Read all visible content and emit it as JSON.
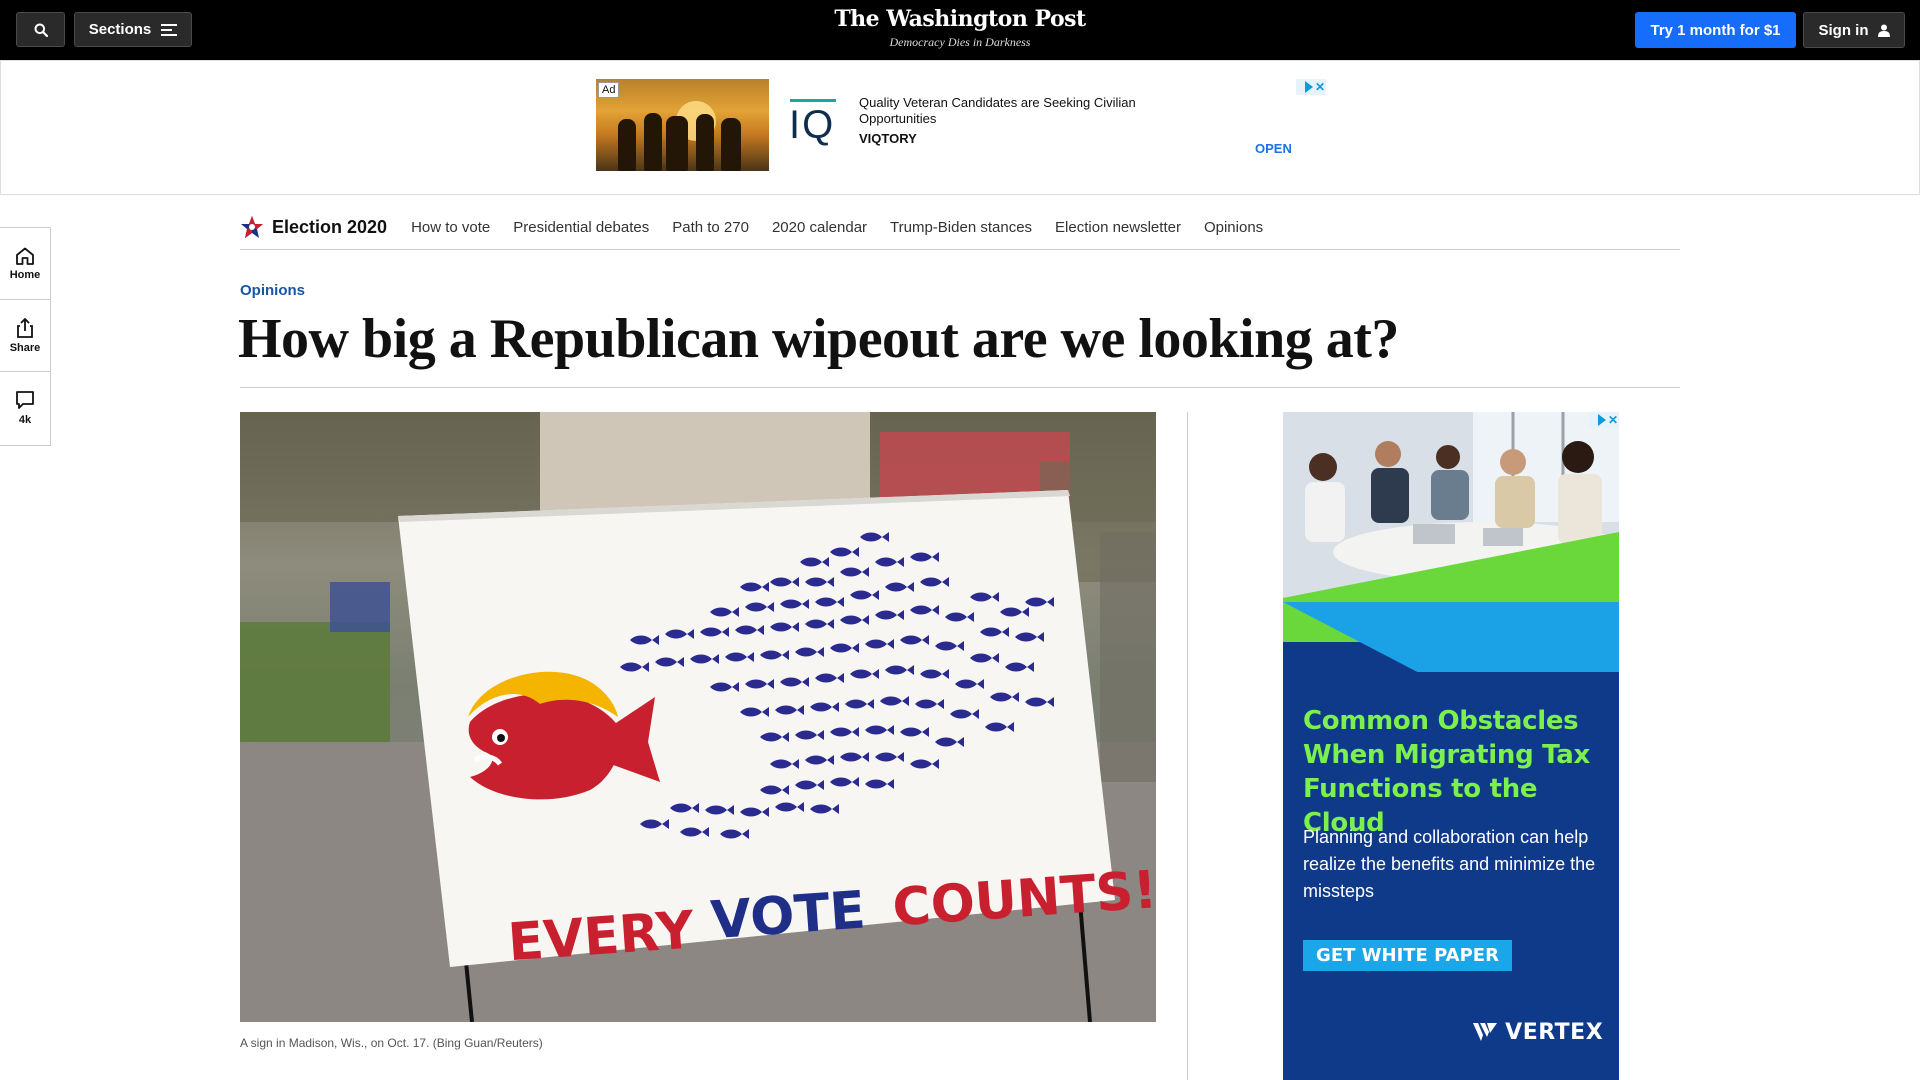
{
  "topbar": {
    "search_icon": "search-icon",
    "sections_label": "Sections",
    "masthead_logo": "The Washington Post",
    "masthead_tagline": "Democracy Dies in Darkness",
    "try_label": "Try 1 month for $1",
    "signin_label": "Sign in"
  },
  "top_ad": {
    "badge": "Ad",
    "logo_text": "IQ",
    "headline": "Quality Veteran Candidates are Seeking Civilian Opportunities",
    "brand": "VIQTORY",
    "cta": "OPEN"
  },
  "election_nav": {
    "title": "Election 2020",
    "links": [
      "How to vote",
      "Presidential debates",
      "Path to 270",
      "2020 calendar",
      "Trump-Biden stances",
      "Election newsletter",
      "Opinions"
    ]
  },
  "left_rail": {
    "home_label": "Home",
    "share_label": "Share",
    "comments_label": "4k"
  },
  "article": {
    "kicker": "Opinions",
    "headline": "How big a Republican wipeout are we looking at?",
    "image_sign_text": [
      "EVERY",
      "VOTE",
      "COUNTS!"
    ],
    "caption": "A sign in Madison, Wis., on Oct. 17. (Bing Guan/Reuters)"
  },
  "right_ad": {
    "headline": "Common Obstacles When Migrating Tax Functions to the Cloud",
    "body": "Planning and collaboration can help realize the benefits and minimize the missteps",
    "cta": "GET WHITE PAPER",
    "brand": "VERTEX"
  },
  "colors": {
    "topbar_bg": "#000000",
    "cta_blue": "#166dfc",
    "kicker_blue": "#1955a5",
    "ad_navy": "#0f3a8a",
    "ad_green": "#7cf04d",
    "sign_red": "#c8202f",
    "sign_navy": "#1f2f88"
  }
}
